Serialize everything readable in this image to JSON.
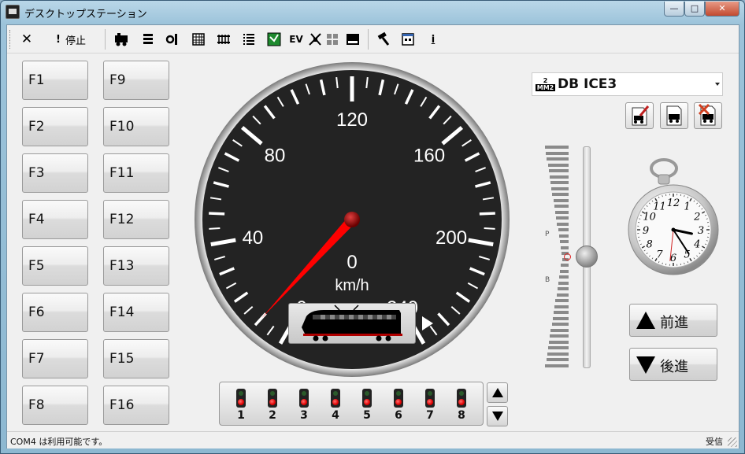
{
  "window": {
    "title": "デスクトップステーション",
    "minimize": "—",
    "maximize": "□",
    "close": "✕"
  },
  "toolbar": {
    "close_glyph": "✕",
    "stop_glyph": "!",
    "stop_label": "停止",
    "ev_label": "EV",
    "info_glyph": "i"
  },
  "function_buttons": [
    "F1",
    "F2",
    "F3",
    "F4",
    "F5",
    "F6",
    "F7",
    "F8",
    "F9",
    "F10",
    "F11",
    "F12",
    "F13",
    "F14",
    "F15",
    "F16"
  ],
  "speedometer": {
    "tick_labels": [
      "0",
      "40",
      "80",
      "120",
      "160",
      "200",
      "240"
    ],
    "speed": "0",
    "unit": "km/h",
    "max": 240,
    "current_value": 10
  },
  "locomotive": {
    "badge_top": "2",
    "badge_bottom": "MM2",
    "name": "DB ICE3"
  },
  "throttle": {
    "label_p": "P",
    "label_b": "B"
  },
  "clock": {
    "numbers": [
      "12",
      "1",
      "2",
      "3",
      "4",
      "5",
      "6",
      "7",
      "8",
      "9",
      "10",
      "11"
    ],
    "hour": 3,
    "minute": 24,
    "second": 31
  },
  "direction": {
    "forward_label": "前進",
    "reverse_label": "後進"
  },
  "accessories": [
    "1",
    "2",
    "3",
    "4",
    "5",
    "6",
    "7",
    "8"
  ],
  "status": {
    "left": "COM4 は利用可能です。",
    "right": "受信"
  },
  "colors": {
    "needle": "#ff0000",
    "signal_red": "#e00000",
    "gauge_face": "#232323"
  }
}
